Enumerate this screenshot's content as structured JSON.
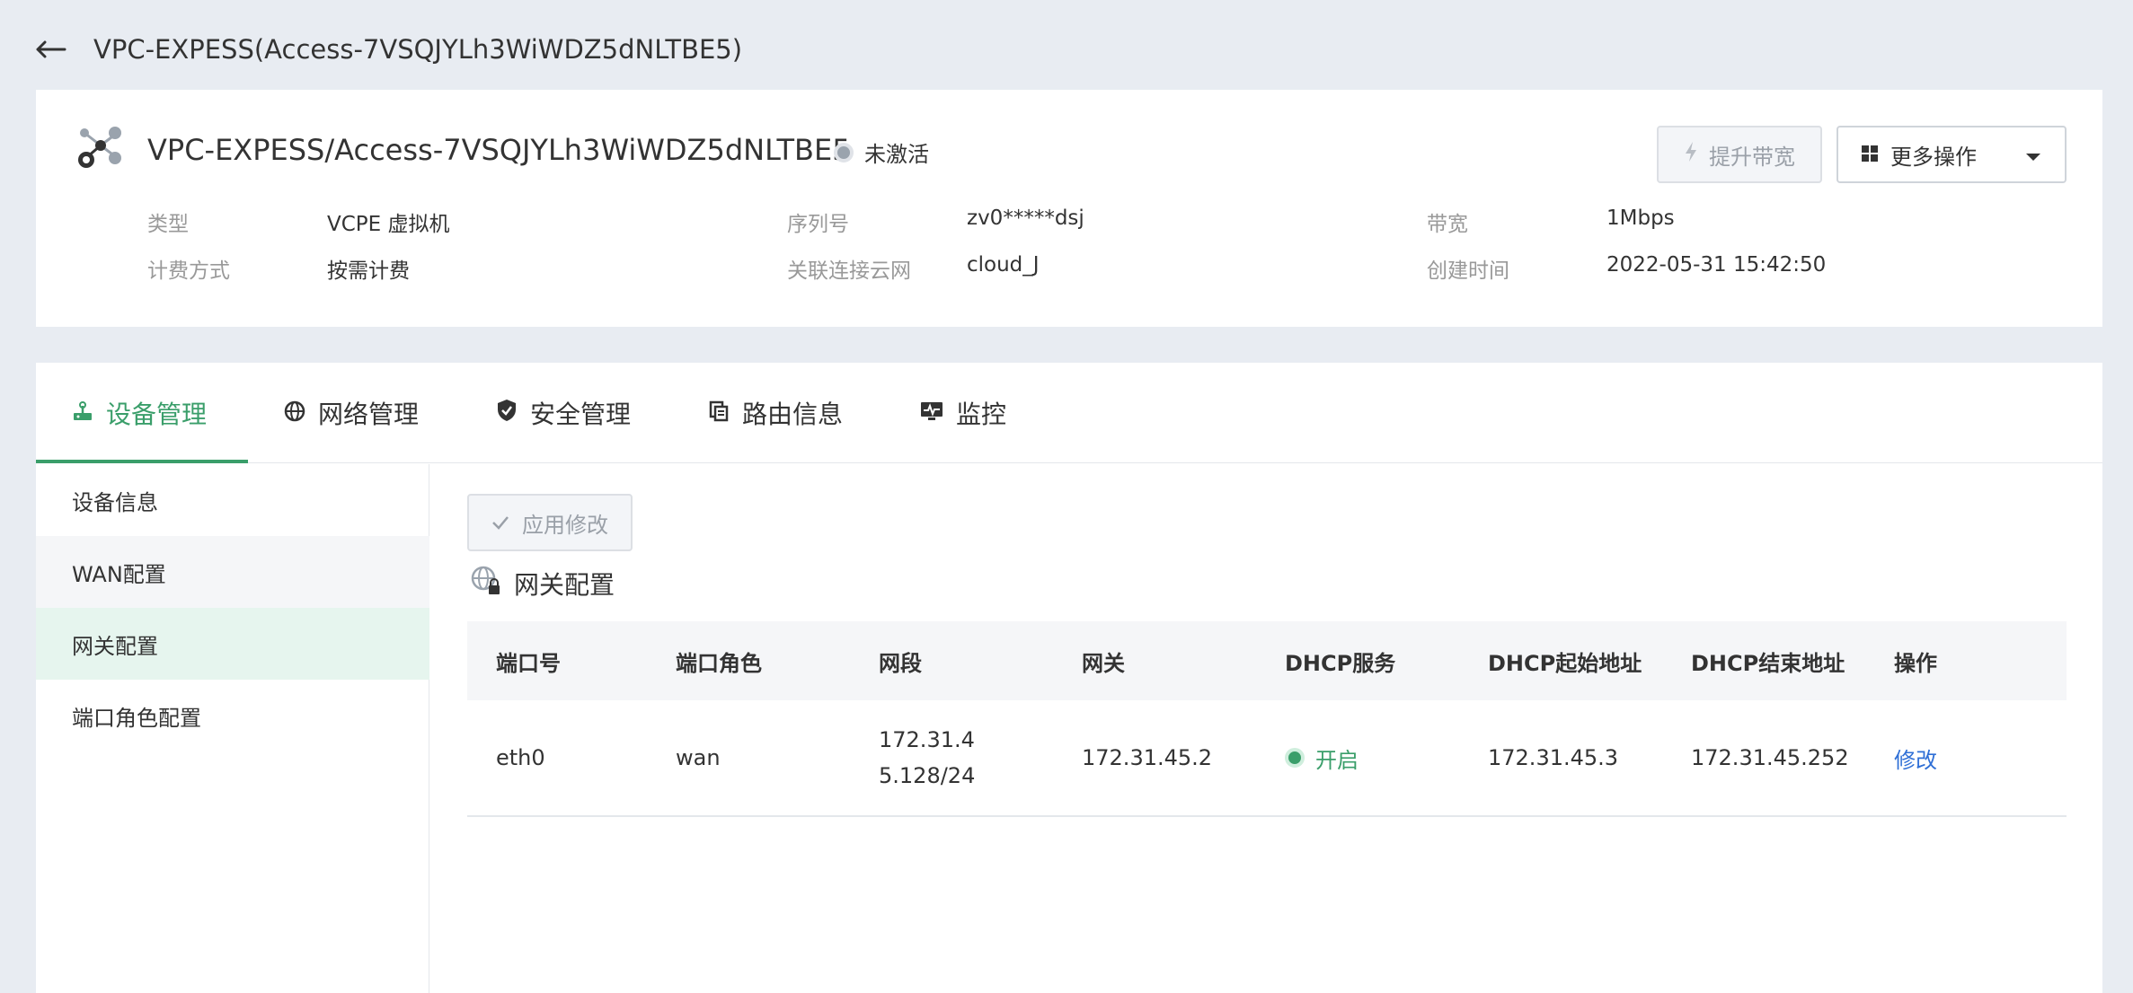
{
  "header": {
    "title": "VPC-EXPESS(Access-7VSQJYLh3WiWDZ5dNLTBE5)"
  },
  "instance": {
    "name": "VPC-EXPESS/Access-7VSQJYLh3WiWDZ5dNLTBE5",
    "status": "未激活",
    "upgrade_label": "提升带宽",
    "more_label": "更多操作",
    "meta": {
      "type_label": "类型",
      "type_value": "VCPE 虚拟机",
      "billing_label": "计费方式",
      "billing_value": "按需计费",
      "serial_label": "序列号",
      "serial_value": "zv0*****dsj",
      "cloud_label": "关联连接云网",
      "cloud_value": "cloud_J",
      "bandwidth_label": "带宽",
      "bandwidth_value": "1Mbps",
      "created_label": "创建时间",
      "created_value": "2022-05-31 15:42:50"
    }
  },
  "tabs": [
    {
      "label": "设备管理",
      "icon": "router-icon"
    },
    {
      "label": "网络管理",
      "icon": "globe-icon"
    },
    {
      "label": "安全管理",
      "icon": "shield-icon"
    },
    {
      "label": "路由信息",
      "icon": "route-doc-icon"
    },
    {
      "label": "监控",
      "icon": "monitor-icon"
    }
  ],
  "sidebar": {
    "items": [
      {
        "label": "设备信息"
      },
      {
        "label": "WAN配置"
      },
      {
        "label": "网关配置"
      },
      {
        "label": "端口角色配置"
      }
    ]
  },
  "main": {
    "apply_label": "应用修改",
    "section_title": "网关配置",
    "table": {
      "headers": [
        "端口号",
        "端口角色",
        "网段",
        "网关",
        "DHCP服务",
        "DHCP起始地址",
        "DHCP结束地址",
        "操作"
      ],
      "rows": [
        {
          "port": "eth0",
          "role": "wan",
          "segment": "172.31.45.128/24",
          "gateway": "172.31.45.2",
          "dhcp": "开启",
          "dhcp_start": "172.31.45.3",
          "dhcp_end": "172.31.45.252",
          "action": "修改"
        }
      ]
    }
  },
  "colors": {
    "accent": "#3a9e6a",
    "link": "#2f6fd6",
    "background": "#e8ecf2"
  }
}
